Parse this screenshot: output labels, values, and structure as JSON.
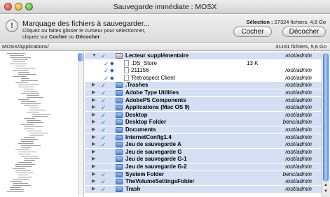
{
  "window": {
    "title": "Sauvegarde immédiate : MOSX"
  },
  "header": {
    "title": "Marquage des fichiers à sauvegarder...",
    "sub_line1": "Cliquez ou faites glisser le curseur pour sélectionner,",
    "sub_line2_prefix": "cliquez sur ",
    "sub_line2_check": "Cocher",
    "sub_line2_mid": " ou ",
    "sub_line2_uncheck": "Décocher",
    "sub_line2_suffix": ".",
    "selection_label": "Sélection :",
    "selection_value": "27324 fichiers, 4,8 Go",
    "check_button": "Cocher",
    "uncheck_button": "Décocher"
  },
  "pathbar": {
    "path": "MOSX/Applications/",
    "summary": "31191 fichiers, 5,6 Go"
  },
  "list": {
    "rows": [
      {
        "name": "Lecteur supplémentaire",
        "size": "",
        "owner": "root/admin",
        "icon": "disk-icon",
        "disclosure": "expanded",
        "checked": true,
        "bold": true
      },
      {
        "name": ".DS_Store",
        "size": "13 K",
        "owner": "",
        "icon": "file-icon",
        "disclosure": "none",
        "checked": true,
        "bold": false
      },
      {
        "name": "211156",
        "size": "",
        "owner": "root/admin",
        "icon": "file-icon",
        "disclosure": "none",
        "checked": true,
        "bold": false
      },
      {
        "name": "'Retrospect Client",
        "size": "",
        "owner": "root/admin",
        "icon": "file-icon",
        "disclosure": "none",
        "checked": true,
        "bold": false
      },
      {
        "name": ".Trashes",
        "size": "",
        "owner": "root/admin",
        "icon": "folder-icon",
        "disclosure": "collapsed",
        "checked": true,
        "bold": true
      },
      {
        "name": "Adobe Type Utilities",
        "size": "",
        "owner": "root/admin",
        "icon": "folder-icon",
        "disclosure": "collapsed",
        "checked": true,
        "bold": true
      },
      {
        "name": "AdobePS Components",
        "size": "",
        "owner": "root/admin",
        "icon": "folder-icon",
        "disclosure": "collapsed",
        "checked": true,
        "bold": true
      },
      {
        "name": "Applications (Mac OS 9)",
        "size": "",
        "owner": "root/admin",
        "icon": "folder-icon",
        "disclosure": "collapsed",
        "checked": true,
        "bold": true
      },
      {
        "name": "Desktop",
        "size": "",
        "owner": "root/admin",
        "icon": "folder-icon",
        "disclosure": "collapsed",
        "checked": true,
        "bold": true
      },
      {
        "name": "Desktop Folder",
        "size": "",
        "owner": "benc/admin",
        "icon": "folder-icon",
        "disclosure": "collapsed",
        "checked": true,
        "bold": true
      },
      {
        "name": "Documents",
        "size": "",
        "owner": "root/admin",
        "icon": "folder-icon",
        "disclosure": "collapsed",
        "checked": true,
        "bold": true
      },
      {
        "name": "InternetConfig1.4",
        "size": "",
        "owner": "root/admin",
        "icon": "folder-icon",
        "disclosure": "collapsed",
        "checked": true,
        "bold": true
      },
      {
        "name": "Jeu de sauvegarde A",
        "size": "",
        "owner": "root/admin",
        "icon": "folder-icon",
        "disclosure": "collapsed",
        "checked": true,
        "bold": true
      },
      {
        "name": "Jeu de sauvegarde G",
        "size": "",
        "owner": "root/admin",
        "icon": "folder-icon",
        "disclosure": "collapsed",
        "checked": false,
        "bold": true
      },
      {
        "name": "Jeu de sauvegarde G-1",
        "size": "",
        "owner": "root/admin",
        "icon": "folder-icon",
        "disclosure": "collapsed",
        "checked": false,
        "bold": true
      },
      {
        "name": "Jeu de sauvegarde G-2",
        "size": "",
        "owner": "root/admin",
        "icon": "folder-icon",
        "disclosure": "collapsed",
        "checked": false,
        "bold": true
      },
      {
        "name": "System Folder",
        "size": "",
        "owner": "benc/admin",
        "icon": "folder-icon",
        "disclosure": "collapsed",
        "checked": true,
        "bold": true
      },
      {
        "name": "TheVolumeSettingsFolder",
        "size": "",
        "owner": "root/admin",
        "icon": "folder-icon",
        "disclosure": "collapsed",
        "checked": true,
        "bold": true
      },
      {
        "name": "Trash",
        "size": "",
        "owner": "root/admin",
        "icon": "folder-icon",
        "disclosure": "collapsed",
        "checked": true,
        "bold": true
      }
    ]
  },
  "colors": {
    "checkmark": "#2a5fc5",
    "highlight": "#d4dff3",
    "scroll_thumb": "#4f83dc"
  }
}
